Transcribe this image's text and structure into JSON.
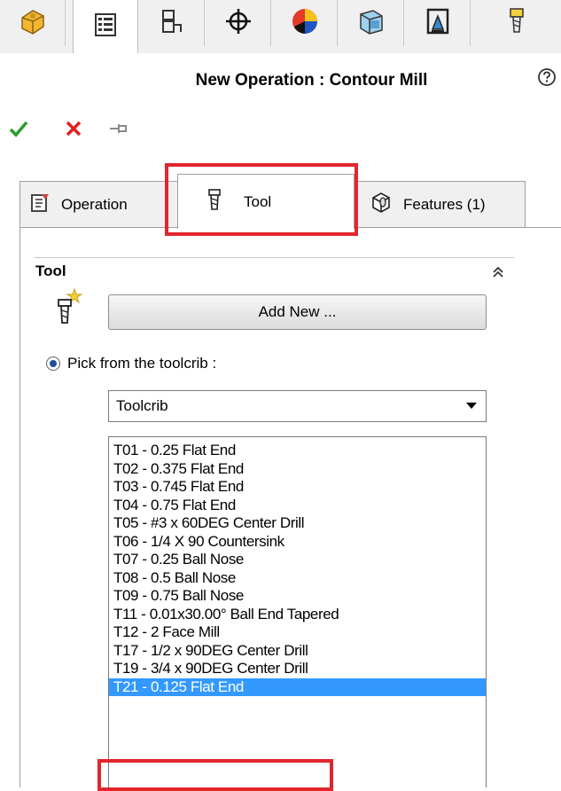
{
  "toolbar": {
    "buttons": [
      {
        "icon": "part-icon"
      },
      {
        "icon": "operations-tree-icon",
        "active": true
      },
      {
        "icon": "setup-icon"
      },
      {
        "icon": "crosshair-icon"
      },
      {
        "icon": "simulation-icon"
      },
      {
        "icon": "stock-icon"
      },
      {
        "icon": "machine-icon"
      },
      {
        "icon": "tool-icon"
      }
    ]
  },
  "header": {
    "title": "New Operation : Contour Mill"
  },
  "actions": {
    "ok": "check-icon",
    "cancel": "close-icon",
    "pin": "pin-icon"
  },
  "tabs": [
    {
      "label": "Operation",
      "icon": "operation-icon"
    },
    {
      "label": "Tool",
      "icon": "tool-icon",
      "active": true
    },
    {
      "label": "Features (1)",
      "icon": "features-icon"
    }
  ],
  "tool_section": {
    "title": "Tool",
    "add_new_label": "Add New ...",
    "pick_label": "Pick from the toolcrib :",
    "select_value": "Toolcrib",
    "tools": [
      "T01 - 0.25 Flat End",
      "T02 - 0.375 Flat End",
      "T03 - 0.745 Flat End",
      "T04 - 0.75 Flat End",
      "T05 - #3 x 60DEG Center Drill",
      "T06 - 1/4 X 90 Countersink",
      "T07 - 0.25 Ball Nose",
      "T08 - 0.5 Ball Nose",
      "T09 - 0.75 Ball Nose",
      "T11 - 0.01x30.00° Ball End Tapered",
      "T12 - 2 Face Mill",
      "T17 - 1/2 x 90DEG Center Drill",
      "T19 - 3/4 x 90DEG Center Drill",
      "T21 - 0.125 Flat End"
    ],
    "selected_index": 13
  },
  "colors": {
    "highlight": "#e1262d",
    "selection": "#3399ff",
    "ok": "#2a9d2a",
    "cancel": "#e02020"
  }
}
